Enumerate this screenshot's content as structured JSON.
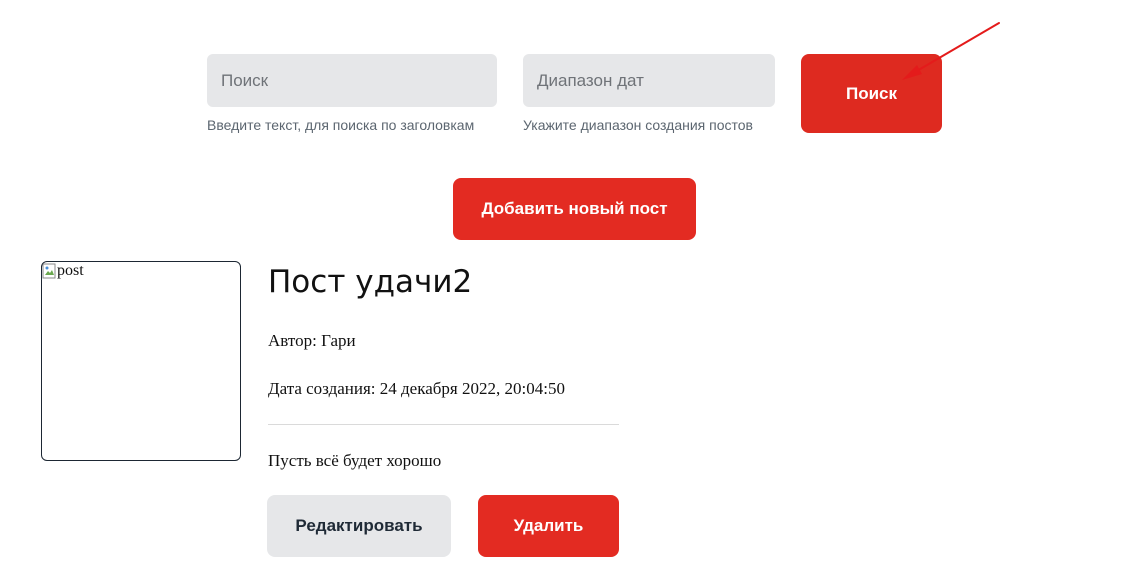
{
  "search": {
    "title_placeholder": "Поиск",
    "title_hint": "Введите текст, для поиска по заголовкам",
    "date_placeholder": "Диапазон дат",
    "date_hint": "Укажите диапазон создания постов",
    "button_label": "Поиск"
  },
  "actions": {
    "add_post_label": "Добавить новый пост"
  },
  "post": {
    "image_alt": "post",
    "title": "Пост удачи2",
    "author_label": "Автор:",
    "author": "Гари",
    "date_label": "Дата создания:",
    "date": "24 декабря 2022, 20:04:50",
    "body": "Пусть всё будет хорошо",
    "edit_label": "Редактировать",
    "delete_label": "Удалить"
  },
  "colors": {
    "accent": "#e32b22",
    "field_bg": "#e6e7e9",
    "annotation_arrow": "#e41b1b"
  },
  "icons": {
    "broken_image": "broken-image-icon",
    "annotation": "arrow-annotation-icon"
  }
}
